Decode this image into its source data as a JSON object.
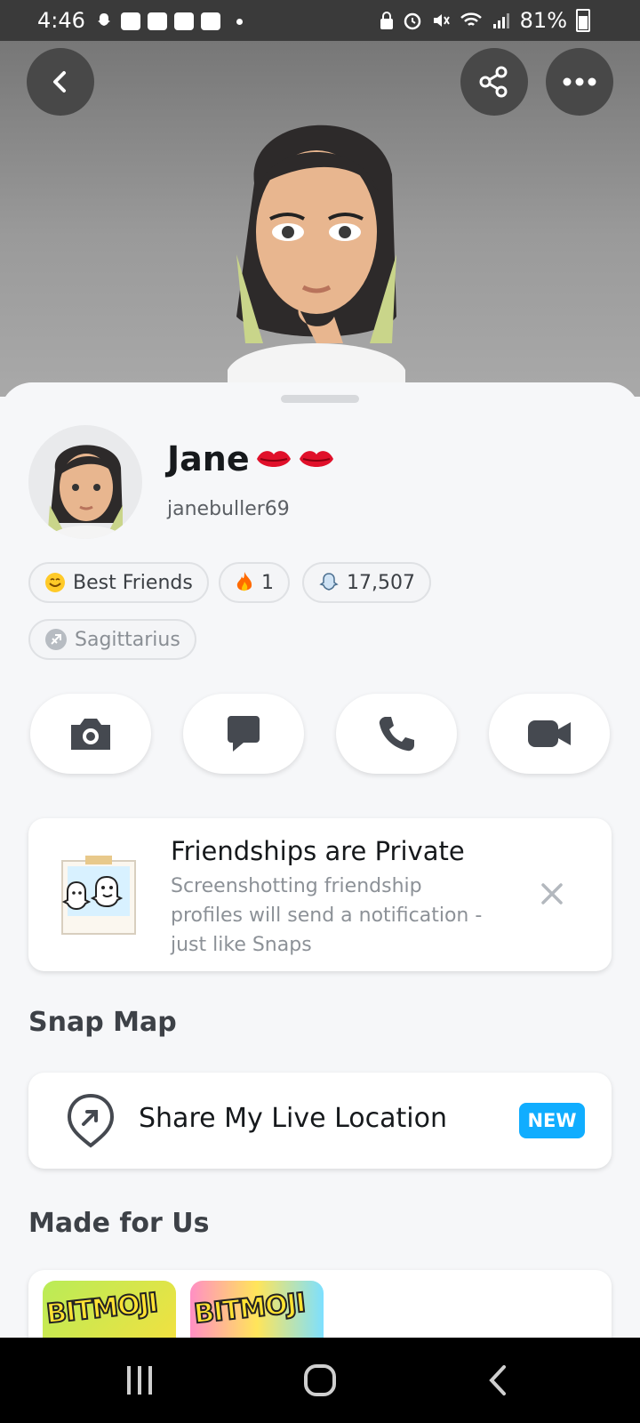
{
  "status_bar": {
    "time": "4:46",
    "battery": "81%",
    "left_icons": [
      "snapchat-icon",
      "facebook-icon",
      "youtube-icon",
      "youtube-icon",
      "youtube-icon",
      "dot-icon"
    ],
    "right_icons": [
      "lock-icon",
      "alarm-icon",
      "mute-icon",
      "wifi-icon",
      "signal-icon",
      "battery-icon"
    ]
  },
  "header": {
    "buttons": [
      "back-icon",
      "share-icon",
      "more-icon"
    ]
  },
  "profile": {
    "name": "Jane",
    "username": "janebuller69"
  },
  "chips": {
    "best_friends": "Best Friends",
    "streak": "1",
    "score": "17,507",
    "zodiac": "Sagittarius"
  },
  "actions": [
    "camera-icon",
    "chat-icon",
    "call-icon",
    "video-icon"
  ],
  "private_card": {
    "title": "Friendships are Private",
    "description": "Screenshotting friendship profiles will send a notification - just like Snaps"
  },
  "snap_map": {
    "section_title": "Snap Map",
    "share_label": "Share My Live Location",
    "badge": "NEW"
  },
  "made_for_us": {
    "section_title": "Made for Us",
    "tiles": [
      "BITMOJI",
      "BITMOJI"
    ]
  },
  "colors": {
    "accent_blue": "#10adff",
    "sheet_bg": "#f6f7f9",
    "header_button": "#484848"
  }
}
